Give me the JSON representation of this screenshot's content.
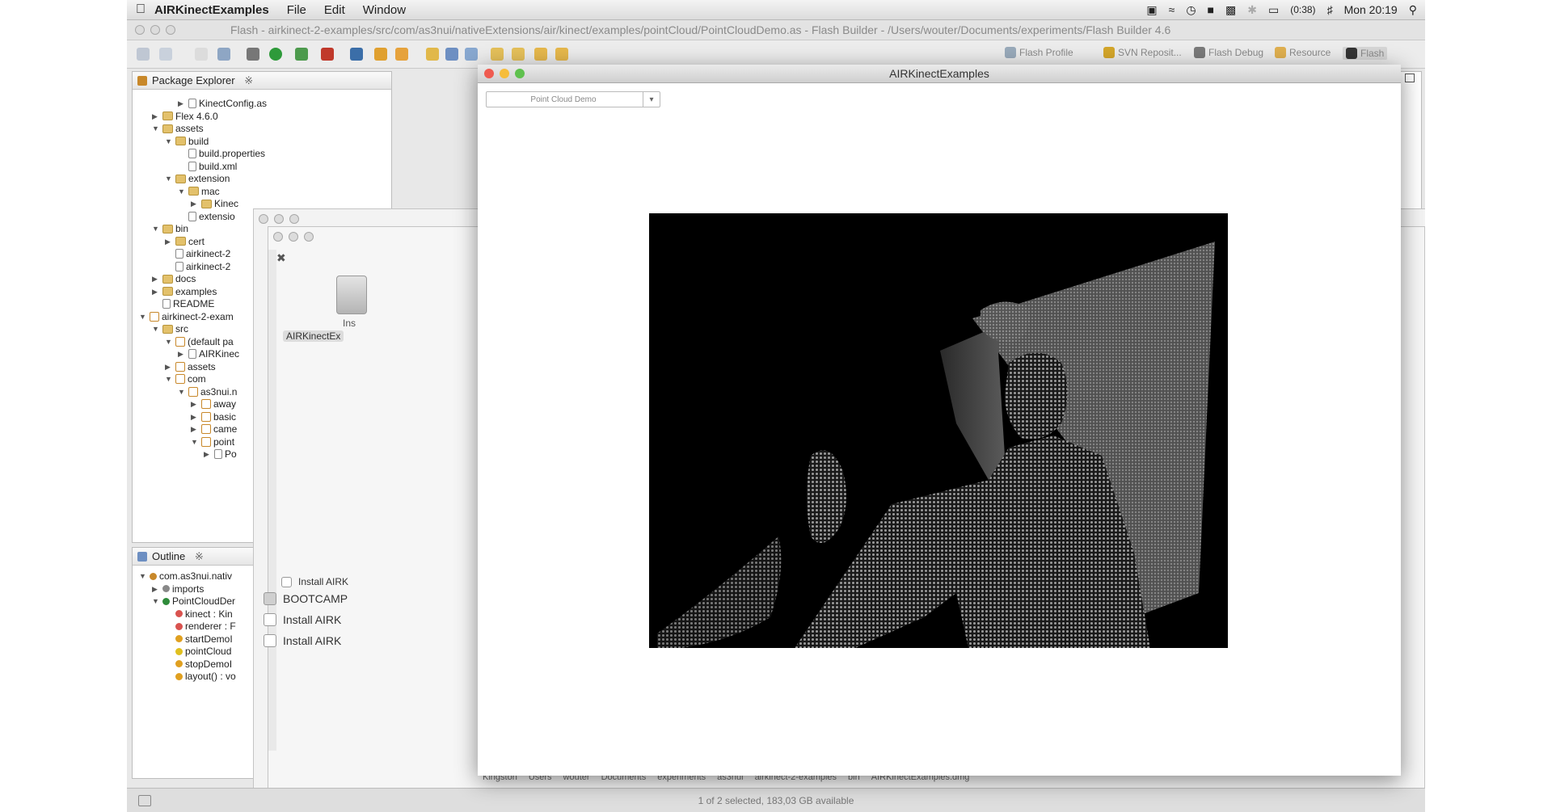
{
  "menubar": {
    "app_name": "AIRKinectExamples",
    "items": [
      "File",
      "Edit",
      "Window"
    ],
    "battery": "(0:38)",
    "clock": "Mon 20:19"
  },
  "eclipse": {
    "title": "Flash - airkinect-2-examples/src/com/as3nui/nativeExtensions/air/kinect/examples/pointCloud/PointCloudDemo.as - Flash Builder - /Users/wouter/Documents/experiments/Flash Builder 4.6",
    "perspectives": [
      "Flash Profile",
      "SVN Reposit...",
      "Flash Debug",
      "Resource",
      "Flash"
    ]
  },
  "package_explorer": {
    "tab": "Package Explorer",
    "rows": [
      {
        "label": "KinectConfig.as",
        "indent": 3,
        "icon": "file",
        "arrow": "▶"
      },
      {
        "label": "Flex 4.6.0",
        "indent": 1,
        "icon": "folder",
        "arrow": "▶"
      },
      {
        "label": "assets",
        "indent": 1,
        "icon": "folder",
        "arrow": "▼"
      },
      {
        "label": "build",
        "indent": 2,
        "icon": "folder",
        "arrow": "▼"
      },
      {
        "label": "build.properties",
        "indent": 3,
        "icon": "file",
        "arrow": ""
      },
      {
        "label": "build.xml",
        "indent": 3,
        "icon": "file",
        "arrow": ""
      },
      {
        "label": "extension",
        "indent": 2,
        "icon": "folder",
        "arrow": "▼"
      },
      {
        "label": "mac",
        "indent": 3,
        "icon": "folder",
        "arrow": "▼"
      },
      {
        "label": "Kinec",
        "indent": 4,
        "icon": "folder",
        "arrow": "▶"
      },
      {
        "label": "extensio",
        "indent": 3,
        "icon": "file",
        "arrow": ""
      },
      {
        "label": "bin",
        "indent": 1,
        "icon": "folder",
        "arrow": "▼"
      },
      {
        "label": "cert",
        "indent": 2,
        "icon": "folder",
        "arrow": "▶"
      },
      {
        "label": "airkinect-2",
        "indent": 2,
        "icon": "file",
        "arrow": ""
      },
      {
        "label": "airkinect-2",
        "indent": 2,
        "icon": "file",
        "arrow": ""
      },
      {
        "label": "docs",
        "indent": 1,
        "icon": "folder",
        "arrow": "▶"
      },
      {
        "label": "examples",
        "indent": 1,
        "icon": "folder",
        "arrow": "▶"
      },
      {
        "label": "README",
        "indent": 1,
        "icon": "file",
        "arrow": ""
      },
      {
        "label": "airkinect-2-exam",
        "indent": 0,
        "icon": "pkg",
        "arrow": "▼"
      },
      {
        "label": "src",
        "indent": 1,
        "icon": "folder",
        "arrow": "▼"
      },
      {
        "label": "(default pa",
        "indent": 2,
        "icon": "pkg",
        "arrow": "▼"
      },
      {
        "label": "AIRKinec",
        "indent": 3,
        "icon": "file",
        "arrow": "▶"
      },
      {
        "label": "assets",
        "indent": 2,
        "icon": "pkg",
        "arrow": "▶"
      },
      {
        "label": "com",
        "indent": 2,
        "icon": "pkg",
        "arrow": "▼"
      },
      {
        "label": "as3nui.n",
        "indent": 3,
        "icon": "pkg",
        "arrow": "▼"
      },
      {
        "label": "away",
        "indent": 4,
        "icon": "pkg",
        "arrow": "▶"
      },
      {
        "label": "basic",
        "indent": 4,
        "icon": "pkg",
        "arrow": "▶"
      },
      {
        "label": "came",
        "indent": 4,
        "icon": "pkg",
        "arrow": "▶"
      },
      {
        "label": "point",
        "indent": 4,
        "icon": "pkg",
        "arrow": "▼"
      },
      {
        "label": "Po",
        "indent": 5,
        "icon": "file",
        "arrow": "▶"
      }
    ]
  },
  "outline": {
    "tab": "Outline",
    "rows": [
      {
        "label": "com.as3nui.nativ",
        "indent": 0,
        "color": "#c8882a",
        "arrow": "▼"
      },
      {
        "label": "imports",
        "indent": 1,
        "color": "#888888",
        "arrow": "▶"
      },
      {
        "label": "PointCloudDer",
        "indent": 1,
        "color": "#2e8b3a",
        "arrow": "▼"
      },
      {
        "label": "kinect : Kin",
        "indent": 2,
        "color": "#d9534f",
        "arrow": ""
      },
      {
        "label": "renderer : F",
        "indent": 2,
        "color": "#d9534f",
        "arrow": ""
      },
      {
        "label": "startDemoI",
        "indent": 2,
        "color": "#e0a020",
        "arrow": ""
      },
      {
        "label": "pointCloud",
        "indent": 2,
        "color": "#e0c020",
        "arrow": ""
      },
      {
        "label": "stopDemoI",
        "indent": 2,
        "color": "#e0a020",
        "arrow": ""
      },
      {
        "label": "layout() : vo",
        "indent": 2,
        "color": "#e0a020",
        "arrow": ""
      }
    ]
  },
  "finder_bg": {
    "icon_label_line1": "Ins",
    "icon_label_line2": "AIRKinectEx",
    "checkbox_items": [
      "Install AIRK",
      "BOOTCAMP",
      "Install AIRK",
      "Install AIRK"
    ],
    "path_items": [
      "Kingston",
      "Users",
      "wouter",
      "Documents",
      "experiments",
      "as3nui",
      "airkinect-2-examples",
      "bin",
      "AIRKinectExamples.dmg"
    ],
    "status": "1 of 2 selected, 183,03 GB available"
  },
  "air_window": {
    "title": "AIRKinectExamples",
    "demo_select_value": "Point Cloud Demo",
    "demo_select_button": "▾"
  }
}
